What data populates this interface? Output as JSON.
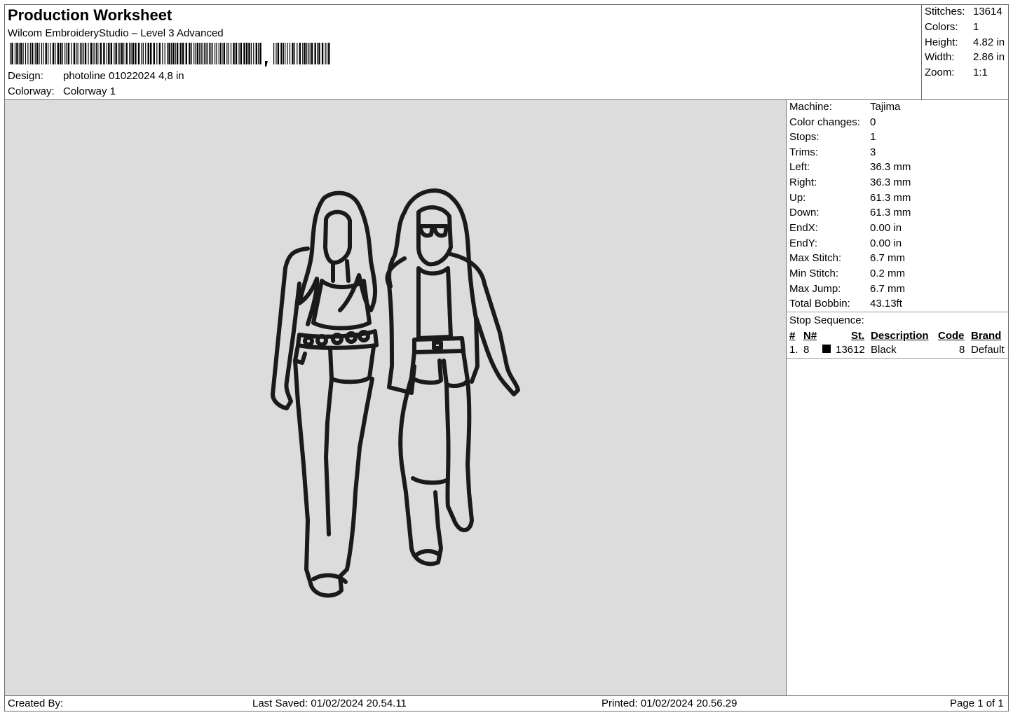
{
  "header": {
    "title": "Production Worksheet",
    "subtitle": "Wilcom EmbroideryStudio – Level 3 Advanced",
    "design_label": "Design:",
    "design_value": "photoline 01022024 4,8 in",
    "colorway_label": "Colorway:",
    "colorway_value": "Colorway 1"
  },
  "summary": [
    {
      "label": "Stitches:",
      "value": "13614"
    },
    {
      "label": "Colors:",
      "value": "1"
    },
    {
      "label": "Height:",
      "value": "4.82 in"
    },
    {
      "label": "Width:",
      "value": "2.86 in"
    },
    {
      "label": "Zoom:",
      "value": "1:1"
    }
  ],
  "machine_info": [
    {
      "label": "Machine:",
      "value": "Tajima"
    },
    {
      "label": "Color changes:",
      "value": "0"
    },
    {
      "label": "Stops:",
      "value": "1"
    },
    {
      "label": "Trims:",
      "value": "3"
    },
    {
      "label": "Left:",
      "value": "36.3 mm"
    },
    {
      "label": "Right:",
      "value": "36.3 mm"
    },
    {
      "label": "Up:",
      "value": "61.3 mm"
    },
    {
      "label": "Down:",
      "value": "61.3 mm"
    },
    {
      "label": "EndX:",
      "value": "0.00 in"
    },
    {
      "label": "EndY:",
      "value": "0.00 in"
    },
    {
      "label": "Max Stitch:",
      "value": "6.7 mm"
    },
    {
      "label": "Min Stitch:",
      "value": "0.2 mm"
    },
    {
      "label": "Max Jump:",
      "value": "6.7 mm"
    },
    {
      "label": "Total Bobbin:",
      "value": "43.13ft"
    }
  ],
  "stop_sequence": {
    "title": "Stop Sequence:",
    "headers": {
      "num": "#",
      "needle": "N#",
      "stitches": "St.",
      "description": "Description",
      "code": "Code",
      "brand": "Brand"
    },
    "rows": [
      {
        "num": "1.",
        "needle": "8",
        "swatch": "#000000",
        "stitches": "13612",
        "description": "Black",
        "code": "8",
        "brand": "Default"
      }
    ]
  },
  "footer": {
    "created_by": "Created By:",
    "last_saved": "Last Saved: 01/02/2024 20.54.11",
    "printed": "Printed: 01/02/2024 20.56.29",
    "page": "Page 1 of 1"
  },
  "colors": {
    "canvas_bg": "#dcdcdc",
    "thread": "#1a1a1a"
  }
}
